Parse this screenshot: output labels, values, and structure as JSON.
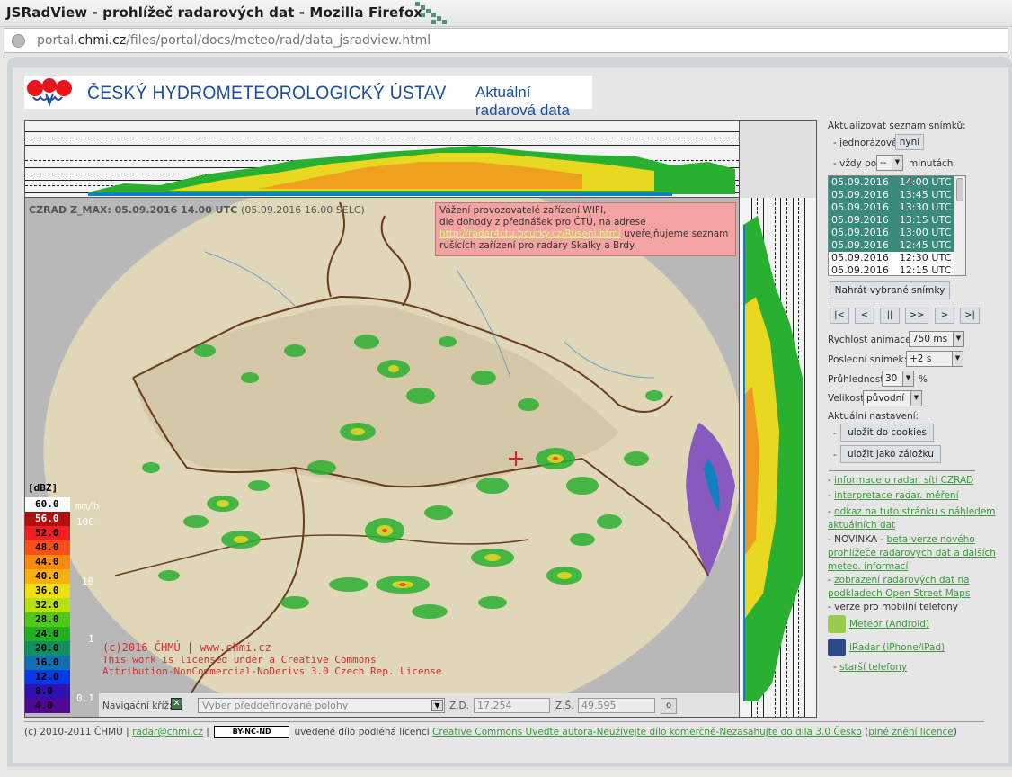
{
  "window": {
    "title": "JSRadView - prohlížeč radarových dat - Mozilla Firefox"
  },
  "address_bar": {
    "prefix": "portal.",
    "domain": "chmi.cz",
    "path": "/files/portal/docs/meteo/rad/data_jsradview.html"
  },
  "header": {
    "org_name": "ČESKÝ HYDROMETEOROLOGICKÝ ÚSTAV",
    "separator": "-",
    "section": "Aktuální radarová data"
  },
  "radar": {
    "product_label": "CZRAD Z_MAX: 05.09.2016 14.00 UTC",
    "local_time": "(05.09.2016 16.00 SELC)",
    "notice": {
      "line1": "Vážení provozovatelé zařízení WIFI,",
      "line2": "dle dohody z přednášek pro ČTÚ, na adrese",
      "link": "http://radar4ctu.bourky.cz/Ruseni.html",
      "line3": " uveřejňujeme seznam",
      "line4": "rušících zařízení pro radary Skalky a Brdy."
    },
    "legend_title": "[dBZ]",
    "legend": [
      {
        "label": "60.0",
        "color": "#ffffff",
        "text": "#000000"
      },
      {
        "label": "56.0",
        "color": "#b01010",
        "text": "#ffffff"
      },
      {
        "label": "52.0",
        "color": "#f02020",
        "text": "#000000"
      },
      {
        "label": "48.0",
        "color": "#f85018",
        "text": "#000000"
      },
      {
        "label": "44.0",
        "color": "#f88a10",
        "text": "#000000"
      },
      {
        "label": "40.0",
        "color": "#f8b010",
        "text": "#000000"
      },
      {
        "label": "36.0",
        "color": "#f0e010",
        "text": "#000000"
      },
      {
        "label": "32.0",
        "color": "#b8e010",
        "text": "#000000"
      },
      {
        "label": "28.0",
        "color": "#50c818",
        "text": "#000000"
      },
      {
        "label": "24.0",
        "color": "#20b020",
        "text": "#000000"
      },
      {
        "label": "20.0",
        "color": "#109060",
        "text": "#000000"
      },
      {
        "label": "16.0",
        "color": "#1070b0",
        "text": "#000000"
      },
      {
        "label": "12.0",
        "color": "#0838e8",
        "text": "#000000"
      },
      {
        "label": "8.0",
        "color": "#3010b0",
        "text": "#000000"
      },
      {
        "label": "4.0",
        "color": "#500890",
        "text": "#000000"
      }
    ],
    "mmh_labels": [
      {
        "label": "mm/h"
      },
      {
        "label": "100"
      },
      {
        "label": "10"
      },
      {
        "label": "1"
      },
      {
        "label": "0.1"
      }
    ],
    "copyright_line": "(c)2016 ČHMÚ | www.chmi.cz",
    "license_line1": "This work is licensed under a Creative Commons",
    "license_line2": "Attribution-NonCommercial-NoDerivs 3.0 Czech Rep. License"
  },
  "navbar": {
    "label": "Navigační kříž:",
    "preset_placeholder": "Vyber předdefinované polohy",
    "lon_label": "Z.D.",
    "lon_value": "17.254",
    "lat_label": "Z.Š.",
    "lat_value": "49.595",
    "go_label": "o"
  },
  "panel": {
    "update_list_label": "Aktualizovat seznam snímků:",
    "once_label": "- jednorázově",
    "now_button": "nyní",
    "every_label": "- vždy po",
    "every_value": "--",
    "minutes_label": "minutách",
    "frames": [
      {
        "date": "05.09.2016",
        "time": "14:00 UTC",
        "selected": true
      },
      {
        "date": "05.09.2016",
        "time": "13:45 UTC",
        "selected": true
      },
      {
        "date": "05.09.2016",
        "time": "13:30 UTC",
        "selected": true
      },
      {
        "date": "05.09.2016",
        "time": "13:15 UTC",
        "selected": true
      },
      {
        "date": "05.09.2016",
        "time": "13:00 UTC",
        "selected": true
      },
      {
        "date": "05.09.2016",
        "time": "12:45 UTC",
        "selected": true
      },
      {
        "date": "05.09.2016",
        "time": "12:30 UTC",
        "selected": false
      },
      {
        "date": "05.09.2016",
        "time": "12:15 UTC",
        "selected": false
      }
    ],
    "load_button": "Nahrát vybrané snímky",
    "nav_buttons": [
      "|<",
      "<",
      "||",
      ">>",
      ">",
      ">|"
    ],
    "speed_label": "Rychlost animace:",
    "speed_value": "750 ms",
    "last_frame_label": "Poslední snímek:",
    "last_frame_value": "+2 s",
    "transparency_label": "Průhlednost",
    "transparency_value": "30",
    "transparency_unit": "%",
    "size_label": "Velikost",
    "size_value": "původní",
    "current_settings_label": "Aktuální nastavení:",
    "save_cookies_button": "uložit do cookies",
    "save_bookmark_button": "uložit jako záložku",
    "links": {
      "info": "informace o radar. síti CZRAD",
      "interpretation": "interpretace radar. měření",
      "link_page": "odkaz na tuto stránku s náhledem aktuálních dat",
      "novinka_prefix": "- NOVINKA - ",
      "beta": "beta-verze nového prohlížeče radarových dat a dalších meteo. informací",
      "osm": "zobrazení radarových dat na podkladech Open Street Maps",
      "mobile_label": "- verze pro mobilní telefony",
      "android": "Meteor (Android)",
      "iradar": "iRadar (iPhone/iPad)",
      "older": "starší telefony"
    }
  },
  "footer": {
    "copyright": "(c) 2010-2011 ČHMÚ |",
    "email": "radar@chmi.cz",
    "sep": "|",
    "cc_badge": "BY-NC-ND",
    "license_text": "uvedené dílo podléhá licenci",
    "license_link": "Creative Commons Uveďte autora-Neužívejte dílo komerčně-Nezasahujte do díla 3.0 Česko",
    "full_open": "(",
    "full_link": "plné znění licence",
    "full_close": ")"
  },
  "colors": {
    "accent_link": "#3a9a3a",
    "selected_row": "#3a8a7e",
    "brand_blue": "#1d4fa0",
    "border_red": "#6b3a1a"
  }
}
